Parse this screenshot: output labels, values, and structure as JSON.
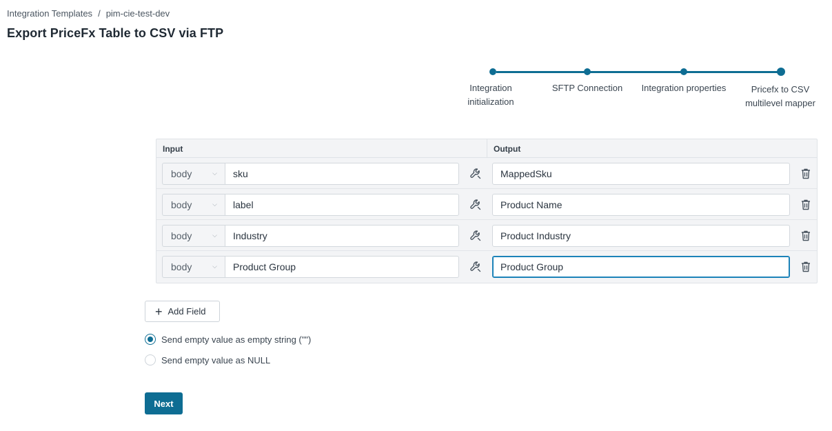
{
  "breadcrumb": {
    "items": [
      "Integration Templates",
      "pim-cie-test-dev"
    ],
    "separator": "/"
  },
  "page": {
    "title": "Export PriceFx Table to CSV via FTP"
  },
  "stepper": {
    "steps": [
      {
        "line1": "Integration",
        "line2": "initialization"
      },
      {
        "line1": "SFTP Connection",
        "line2": ""
      },
      {
        "line1": "Integration properties",
        "line2": ""
      },
      {
        "line1": "Pricefx to CSV",
        "line2": "multilevel mapper"
      }
    ],
    "current_step": 4,
    "accent_color": "#0e6d93"
  },
  "mapper": {
    "headers": {
      "input": "Input",
      "output": "Output"
    },
    "rows": [
      {
        "source": "body",
        "input": "sku",
        "output": "MappedSku"
      },
      {
        "source": "body",
        "input": "label",
        "output": "Product Name"
      },
      {
        "source": "body",
        "input": "Industry",
        "output": "Product Industry"
      },
      {
        "source": "body",
        "input": "Product Group",
        "output": "Product Group"
      }
    ],
    "focused_output_row": 4,
    "row_icons": {
      "transform": "wrench-icon",
      "delete": "trash-icon"
    }
  },
  "actions": {
    "add_field_label": "Add Field",
    "next_label": "Next"
  },
  "empty_value_options": {
    "selected": 0,
    "options": [
      "Send empty value as empty string (\"\")",
      "Send empty value as NULL"
    ]
  }
}
